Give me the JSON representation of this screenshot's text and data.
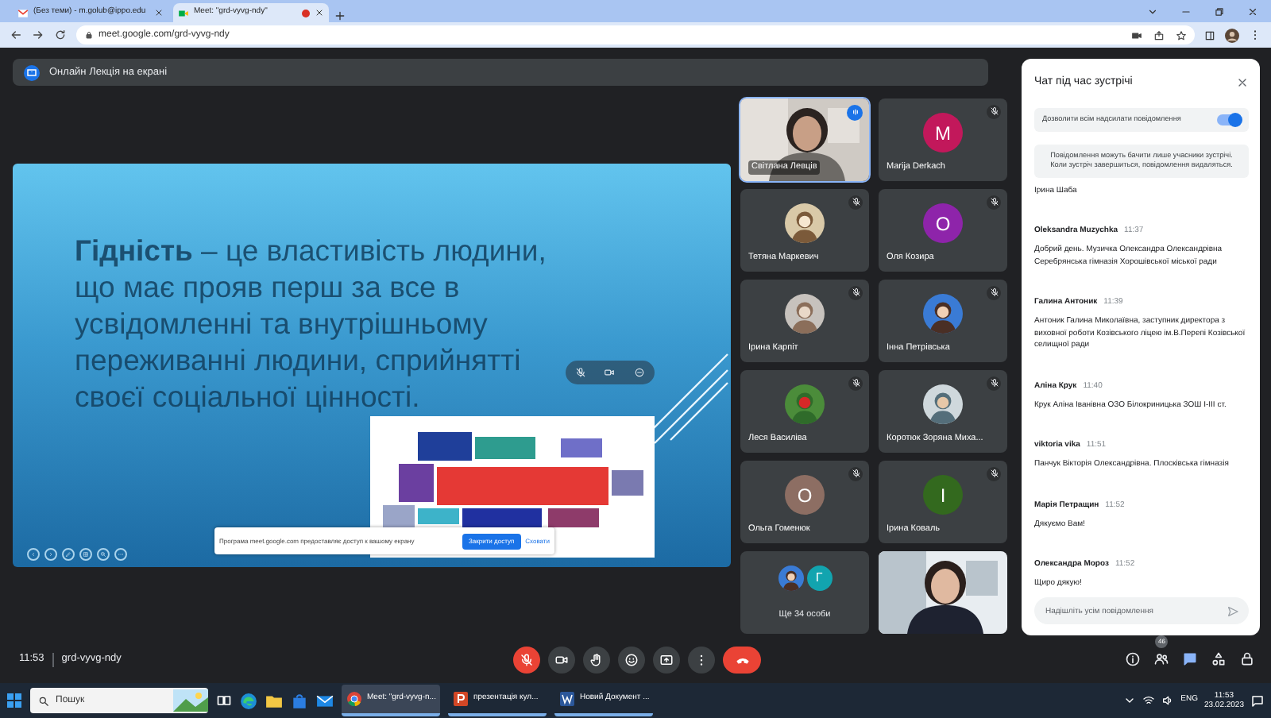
{
  "browser": {
    "tabs": [
      {
        "kind": "mail",
        "title": "(Без теми) - m.golub@ippo.edu",
        "selected": false,
        "live": false
      },
      {
        "kind": "meet",
        "title": "Meet: \"grd-vyvg-ndy\"",
        "selected": true,
        "live": true
      }
    ],
    "address": "meet.google.com/grd-vyvg-ndy"
  },
  "banner": {
    "text": "Онлайн Лекція на екрані"
  },
  "slide": {
    "text": "**Гідність** – це властивість людини,\nщо має прояв перш за все в\nусвідомленні та внутрішньому\nпереживанні людини, сприйнятті\nсвоєї соціальної цінності."
  },
  "share_bar": {
    "message": "Програма meet.google.com предоставляє доступ к вашому екрану",
    "stop_button": "Закрити доступ",
    "hide_link": "Сховати"
  },
  "tiles": [
    {
      "kind": "video",
      "name": "Світлана Левців",
      "muted": false,
      "speaking": true
    },
    {
      "kind": "letter",
      "name": "Marija Derkach",
      "letter": "M",
      "color": "#c2185b",
      "muted": true,
      "speaking": false
    },
    {
      "name": "Тетяна Маркевич",
      "muted": true,
      "speaking": false
    },
    {
      "kind": "letter",
      "name": "Оля Козира",
      "letter": "О",
      "color": "#8e24aa",
      "muted": true,
      "speaking": false
    },
    {
      "name": "Ірина Карпіт",
      "muted": true,
      "speaking": false
    },
    {
      "name": "Інна Петрівська",
      "muted": true,
      "speaking": false
    },
    {
      "name": "Леся Василіва",
      "muted": true,
      "speaking": false
    },
    {
      "name": "Коротюк Зоряна Миха...",
      "muted": true,
      "speaking": false
    },
    {
      "kind": "letter",
      "name": "Ольга Гоменюк",
      "letter": "О",
      "color": "#8d6e63",
      "muted": true,
      "speaking": false
    },
    {
      "kind": "letter",
      "name": "Ірина Коваль",
      "letter": "І",
      "color": "#33691e",
      "muted": true,
      "speaking": false
    },
    {
      "kind": "more",
      "name": "Ще 34 особи",
      "letter": "Г",
      "color": "#12a4af",
      "muted": false,
      "speaking": false
    },
    {
      "kind": "self",
      "muted": false,
      "speaking": false
    }
  ],
  "chat": {
    "title": "Чат під час зустрічі",
    "allow_all": {
      "label": "Дозволити всім надсилати повідомлення",
      "on": true
    },
    "notice": "Повідомлення можуть бачити лише учасники зустрічі. Коли зустріч завершиться, повідомлення видаляться.",
    "messages": [
      {
        "text": "Ірина Шаба"
      },
      {
        "sender": "Oleksandra Muzychka",
        "time": "11:37",
        "text": "Добрий день. Музичка Олександра Олександрівна Серебрянська гімназія Хорошівської міської ради"
      },
      {
        "sender": "Галина Антоник",
        "time": "11:39",
        "text": "Антоник Галина Миколаївна, заступник директора з виховної роботи Козівського ліцею ім.В.Перепі Козівської селищної ради"
      },
      {
        "sender": "Аліна Крук",
        "time": "11:40",
        "text": "Крук Аліна Іванівна ОЗО Білокриницька ЗОШ І-ІІІ ст."
      },
      {
        "sender": "viktoria vika",
        "time": "11:51",
        "text": "Панчук Вікторія Олександрівна. Плосківська гімназія"
      },
      {
        "sender": "Марія Петращин",
        "time": "11:52",
        "text": "Дякуємо Вам!"
      },
      {
        "sender": "Олександра Мороз",
        "time": "11:52",
        "text": "Щиро дякую!"
      }
    ],
    "input": {
      "placeholder": "Надішліть усім повідомлення"
    }
  },
  "meeting": {
    "time": "11:53",
    "code": "grd-vyvg-ndy"
  },
  "controls": [
    {
      "kind": "mic",
      "off": true
    },
    {
      "kind": "camera",
      "off": false
    },
    {
      "kind": "hand",
      "off": false
    },
    {
      "kind": "emoji",
      "off": false
    },
    {
      "kind": "present",
      "off": false
    },
    {
      "kind": "more",
      "off": false
    },
    {
      "kind": "leave"
    }
  ],
  "side_controls": [
    {
      "kind": "info",
      "selected": false
    },
    {
      "kind": "people",
      "selected": false,
      "badge": "46"
    },
    {
      "kind": "chat",
      "selected": true
    },
    {
      "kind": "activities",
      "selected": false
    },
    {
      "kind": "lock",
      "selected": false
    }
  ],
  "taskbar": {
    "search": {
      "placeholder": "Пошук"
    },
    "apps": [
      {
        "kind": "chrome",
        "label": "Meet: \"grd-vyvg-n...",
        "selected": true
      },
      {
        "kind": "powerpoint",
        "label": "презентація кул...",
        "selected": false
      },
      {
        "kind": "word",
        "label": "Новий Документ ...",
        "selected": false
      }
    ],
    "language": "ENG",
    "time": "11:53",
    "date": "23.02.2023"
  }
}
